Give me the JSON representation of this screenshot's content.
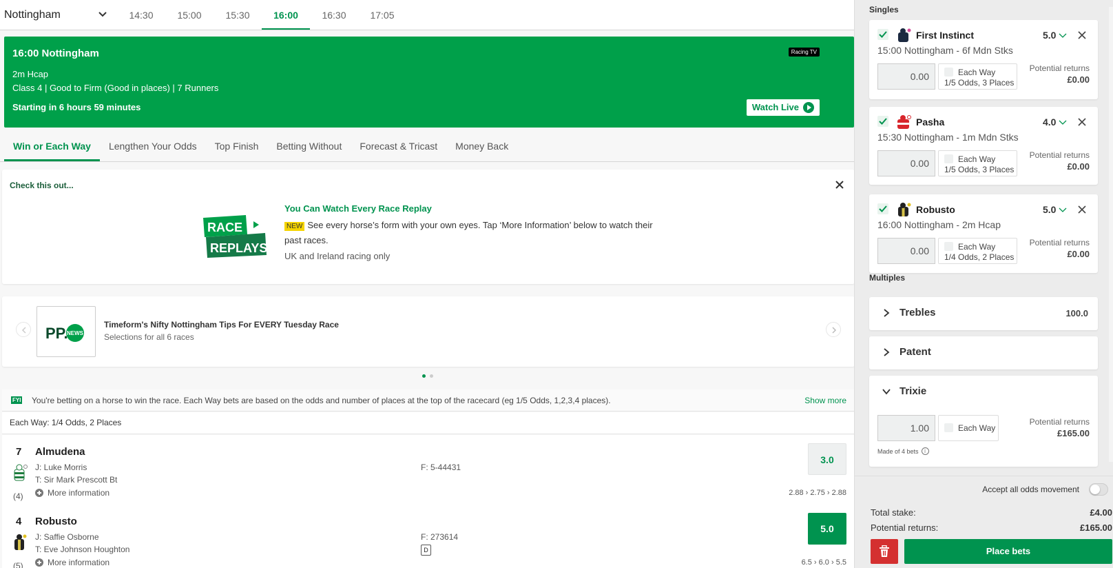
{
  "race_nav": {
    "meeting": "Nottingham",
    "times": [
      "14:30",
      "15:00",
      "15:30",
      "16:00",
      "16:30",
      "17:05"
    ],
    "active_time": "16:00"
  },
  "banner": {
    "title": "16:00 Nottingham",
    "race_type": "2m Hcap",
    "details": "Class 4 | Good to Firm (Good in places) | 7 Runners",
    "countdown": "Starting in 6 hours 59 minutes",
    "broadcaster": "Racing TV",
    "watch_label": "Watch Live"
  },
  "market_tabs": [
    "Win or Each Way",
    "Lengthen Your Odds",
    "Top Finish",
    "Betting Without",
    "Forecast & Tricast",
    "Money Back"
  ],
  "promo": {
    "heading": "Check this out...",
    "logo_line1": "RACE",
    "logo_line2": "REPLAYS",
    "title": "You Can Watch Every Race Replay",
    "new_tag": "NEW",
    "body": "See every horse’s form with your own eyes. Tap ‘More Information’ below to watch their past races.",
    "note": "UK and Ireland racing only"
  },
  "news": {
    "logo_text": "PP.",
    "logo_badge": "NEWS",
    "title": "Timeform's Nifty Nottingham Tips For EVERY Tuesday Race",
    "subtitle": "Selections for all 6 races"
  },
  "fyi": {
    "tag": "FYI",
    "text": "You're betting on a horse to win the race. Each Way bets are based on the odds and number of places at the top of the racecard (eg 1/5 Odds, 1,2,3,4 places).",
    "show_more": "Show more"
  },
  "each_way_terms": "Each Way: 1/4 Odds, 2 Places",
  "runners": [
    {
      "number": "7",
      "draw": "(4)",
      "name": "Almudena",
      "jockey": "J: Luke Morris",
      "trainer": "T: Sir Mark Prescott Bt",
      "form": "F: 5-44431",
      "more": "More information",
      "odds": "3.0",
      "history": "2.88 › 2.75 › 2.88",
      "selected": false
    },
    {
      "number": "4",
      "draw": "(5)",
      "name": "Robusto",
      "jockey": "J: Saffie Osborne",
      "trainer": "T: Eve Johnson Houghton",
      "form": "F: 273614",
      "badge": "D",
      "more": "More information",
      "odds": "5.0",
      "history": "6.5 › 6.0 › 5.5",
      "selected": true
    }
  ],
  "betslip": {
    "singles_label": "Singles",
    "singles": [
      {
        "name": "First Instinct",
        "odds": "5.0",
        "race": "15:00 Nottingham - 6f Mdn Stks",
        "stake": "0.00",
        "ew_label": "Each Way",
        "ew_terms": "1/5 Odds, 3 Places",
        "returns_label": "Potential returns",
        "returns": "£0.00"
      },
      {
        "name": "Pasha",
        "odds": "4.0",
        "race": "15:30 Nottingham - 1m Mdn Stks",
        "stake": "0.00",
        "ew_label": "Each Way",
        "ew_terms": "1/5 Odds, 3 Places",
        "returns_label": "Potential returns",
        "returns": "£0.00"
      },
      {
        "name": "Robusto",
        "odds": "5.0",
        "race": "16:00 Nottingham - 2m Hcap",
        "stake": "0.00",
        "ew_label": "Each Way",
        "ew_terms": "1/4 Odds, 2 Places",
        "returns_label": "Potential returns",
        "returns": "£0.00"
      }
    ],
    "multiples_label": "Multiples",
    "trebles": {
      "name": "Trebles",
      "odds": "100.0"
    },
    "patent": {
      "name": "Patent"
    },
    "trixie": {
      "name": "Trixie",
      "stake": "1.00",
      "ew_label": "Each Way",
      "returns_label": "Potential returns",
      "returns": "£165.00",
      "made_of": "Made of 4 bets"
    },
    "accept_odds": "Accept all odds movement",
    "total_stake_label": "Total stake:",
    "total_stake": "£4.00",
    "potential_returns_label": "Potential returns:",
    "potential_returns": "£165.00",
    "place_bets": "Place bets"
  },
  "colors": {
    "brand_green": "#00934f",
    "banner_green": "#00a04a",
    "delete_red": "#d43030"
  }
}
